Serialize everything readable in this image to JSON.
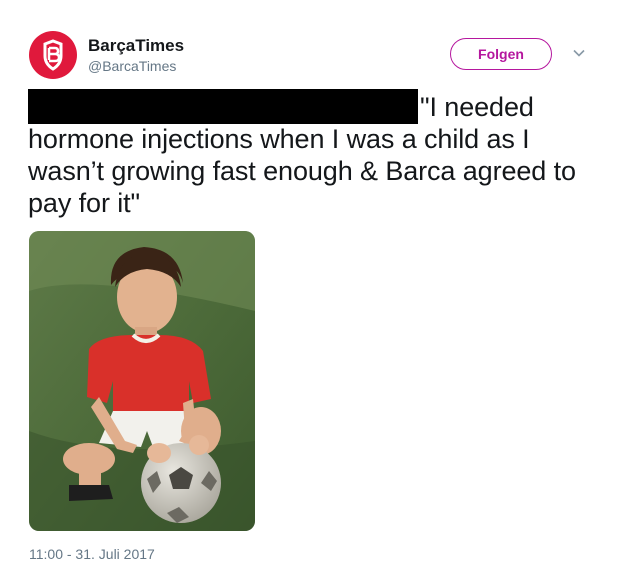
{
  "account": {
    "name": "BarçaTimes",
    "handle": "@BarcaTimes",
    "avatar_icon": "barcatimes-logo-icon",
    "brand_color": "#e0193c"
  },
  "actions": {
    "follow_label": "Folgen",
    "follow_color": "#b5179e",
    "menu_icon": "chevron-down-icon"
  },
  "tweet": {
    "text": "\"I needed hormone injections when I was a child as I wasn’t growing fast enough & Barca agreed to pay for it\"",
    "redacted": true
  },
  "media": {
    "icon": "photo-child-with-football"
  },
  "meta": {
    "timestamp": "11:00 - 31. Juli 2017"
  }
}
